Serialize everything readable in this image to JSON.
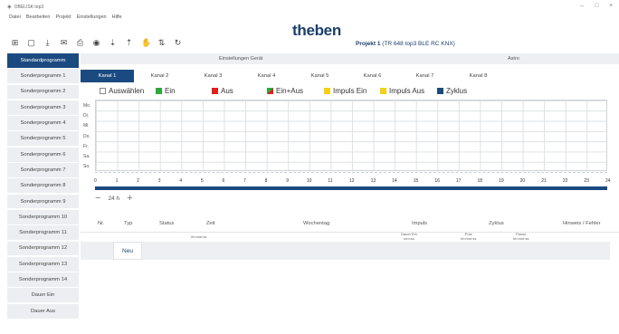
{
  "window": {
    "app_title": "OBELISK top3",
    "controls": [
      "–",
      "□",
      "×"
    ]
  },
  "menu": [
    "Datei",
    "Bearbeiten",
    "Projekt",
    "Einstellungen",
    "Hilfe"
  ],
  "toolbar": [
    {
      "icon": "new-file-icon",
      "glyph": "⊞"
    },
    {
      "icon": "open-file-icon",
      "glyph": "▢"
    },
    {
      "icon": "download-icon",
      "glyph": "⤓"
    },
    {
      "icon": "mail-icon",
      "glyph": "✉"
    },
    {
      "icon": "print-icon",
      "glyph": "⎙"
    },
    {
      "icon": "view-icon",
      "glyph": "◉"
    },
    {
      "icon": "transfer-down-icon",
      "glyph": "⇣"
    },
    {
      "icon": "transfer-up-icon",
      "glyph": "⇡"
    },
    {
      "icon": "hand-icon",
      "glyph": "✋"
    },
    {
      "icon": "sort-icon",
      "glyph": "⇅"
    },
    {
      "icon": "refresh-icon",
      "glyph": "↻"
    }
  ],
  "brand": "theben",
  "project": {
    "label": "Projekt 1",
    "device": "(TR 648 top3 BLE RC KNX)"
  },
  "sidebar": [
    "Standardprogramm",
    "Sonderprogramm 1",
    "Sonderprogramm 2",
    "Sonderprogramm 3",
    "Sonderprogramm 4",
    "Sonderprogramm 5",
    "Sonderprogramm 6",
    "Sonderprogramm 7",
    "Sonderprogramm 8",
    "Sonderprogramm 9",
    "Sonderprogramm 10",
    "Sonderprogramm 11",
    "Sonderprogramm 12",
    "Sonderprogramm 13",
    "Sonderprogramm 14",
    "Dauer Ein",
    "Dauer Aus"
  ],
  "section_tabs": {
    "device": "Einstellungen Gerät",
    "astro": "Astro"
  },
  "channel_tabs": [
    "Kanal 1",
    "Kanal 2",
    "Kanal 3",
    "Kanal 4",
    "Kanal 5",
    "Kanal 6",
    "Kanal 7",
    "Kanal 8"
  ],
  "legend": [
    {
      "label": "Auswählen",
      "color": "#ffffff"
    },
    {
      "label": "Ein",
      "color": "#2eaa3a"
    },
    {
      "label": "Aus",
      "color": "#e02020"
    },
    {
      "label": "Ein+Aus",
      "color": "split"
    },
    {
      "label": "Impuls Ein",
      "color": "#f2d019"
    },
    {
      "label": "Impuls Aus",
      "color": "#f2d019"
    },
    {
      "label": "Zyklus",
      "color": "#1b4a80"
    }
  ],
  "days": [
    "Mo.",
    "Di.",
    "Mi.",
    "Do.",
    "Fr.",
    "Sa.",
    "So."
  ],
  "hours": [
    "0",
    "1",
    "2",
    "3",
    "4",
    "5",
    "6",
    "7",
    "8",
    "9",
    "10",
    "11",
    "12",
    "13",
    "14",
    "15",
    "16",
    "17",
    "18",
    "19",
    "20",
    "21",
    "22",
    "23",
    "24"
  ],
  "zoom": {
    "minus": "−",
    "label": "24 h",
    "plus": "+"
  },
  "table": {
    "headers": [
      "Nr.",
      "Typ",
      "Status",
      "Zeit",
      "Wochentag",
      "Impuls",
      "Zyklus",
      "Hinweis / Fehler"
    ],
    "subheaders": [
      "hh:mm:ss",
      "Dauer Ein\nmm:ss",
      "Puls\nhh:mm:ss",
      "Pause\nhh:mm:ss"
    ],
    "new_button": "Neu"
  },
  "colors": {
    "accent": "#1b4a80",
    "brand": "#1b3f6e",
    "panel": "#edeff2"
  }
}
